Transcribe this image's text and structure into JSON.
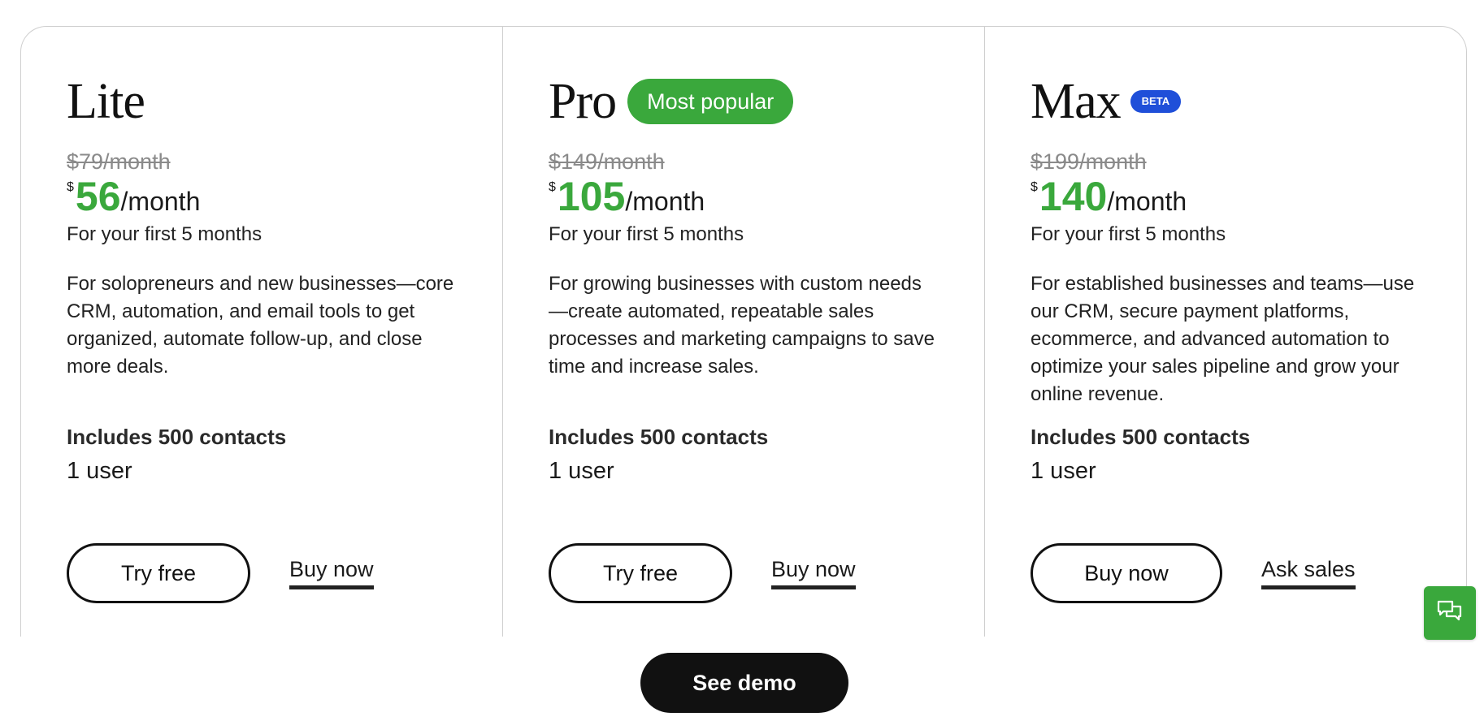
{
  "plans": [
    {
      "name": "Lite",
      "badge": "",
      "old_price": "$79/month",
      "currency": "$",
      "amount": "56",
      "per": "/month",
      "intro_term": "For your first 5 months",
      "description": "For solopreneurs and new businesses—core CRM, automation, and email tools to get organized, automate follow-up, and close more deals.",
      "contacts": "Includes 500 contacts",
      "users": "1 user",
      "primary_cta": "Try free",
      "secondary_cta": "Buy now"
    },
    {
      "name": "Pro",
      "badge": "Most popular",
      "old_price": "$149/month",
      "currency": "$",
      "amount": "105",
      "per": "/month",
      "intro_term": "For your first 5 months",
      "description": "For growing businesses with custom needs—create automated, repeatable sales processes and marketing campaigns to save time and increase sales.",
      "contacts": "Includes 500 contacts",
      "users": "1 user",
      "primary_cta": "Try free",
      "secondary_cta": "Buy now"
    },
    {
      "name": "Max",
      "badge": "BETA",
      "old_price": "$199/month",
      "currency": "$",
      "amount": "140",
      "per": "/month",
      "intro_term": "For your first 5 months",
      "description": "For established businesses and teams—use our CRM, secure payment platforms, ecommerce, and advanced automation to optimize your sales pipeline and grow your online revenue.",
      "contacts": "Includes 500 contacts",
      "users": "1 user",
      "primary_cta": "Buy now",
      "secondary_cta": "Ask sales"
    }
  ],
  "see_demo_label": "See demo",
  "chat_icon": "chat-bubbles-icon",
  "colors": {
    "accent_green": "#3aa83c",
    "beta_blue": "#1f4fd9",
    "dark": "#111111",
    "border": "#cfcfcf"
  }
}
